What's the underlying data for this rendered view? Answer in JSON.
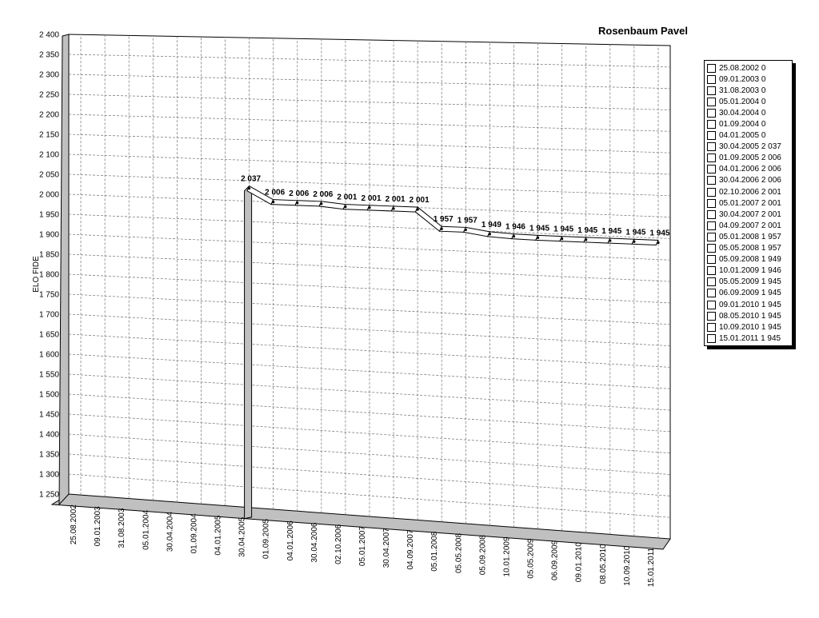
{
  "chart_data": {
    "type": "line",
    "title": "Rosenbaum Pavel",
    "ylabel": "ELO FIDE",
    "xlabel": "",
    "ylim": [
      1250,
      2400
    ],
    "ytick_step": 50,
    "yticks": [
      "1 250",
      "1 300",
      "1 350",
      "1 400",
      "1 450",
      "1 500",
      "1 550",
      "1 600",
      "1 650",
      "1 700",
      "1 750",
      "1 800",
      "1 850",
      "1 900",
      "1 950",
      "2 000",
      "2 050",
      "2 100",
      "2 150",
      "2 200",
      "2 250",
      "2 300",
      "2 350",
      "2 400"
    ],
    "grid": true,
    "legend_position": "right",
    "categories": [
      "25.08.2002",
      "09.01.2003",
      "31.08.2003",
      "05.01.2004",
      "30.04.2004",
      "01.09.2004",
      "04.01.2005",
      "30.04.2005",
      "01.09.2005",
      "04.01.2006",
      "30.04.2006",
      "02.10.2006",
      "05.01.2007",
      "30.04.2007",
      "04.09.2007",
      "05.01.2008",
      "05.05.2008",
      "05.09.2008",
      "10.01.2009",
      "05.05.2009",
      "06.09.2009",
      "09.01.2010",
      "08.05.2010",
      "10.09.2010",
      "15.01.2011"
    ],
    "values": [
      0,
      0,
      0,
      0,
      0,
      0,
      0,
      2037,
      2006,
      2006,
      2006,
      2001,
      2001,
      2001,
      2001,
      1957,
      1957,
      1949,
      1946,
      1945,
      1945,
      1945,
      1945,
      1945,
      1945
    ],
    "data_labels": [
      "",
      "",
      "",
      "",
      "",
      "",
      "",
      "2 037",
      "2 006",
      "2 006",
      "2 006",
      "2 001",
      "2 001",
      "2 001",
      "2 001",
      "1 957",
      "1 957",
      "1 949",
      "1 946",
      "1 945",
      "1 945",
      "1 945",
      "1 945",
      "1 945",
      "1 945"
    ],
    "legend_entries": [
      "25.08.2002 0",
      "09.01.2003 0",
      "31.08.2003 0",
      "05.01.2004 0",
      "30.04.2004 0",
      "01.09.2004 0",
      "04.01.2005 0",
      "30.04.2005 2 037",
      "01.09.2005 2 006",
      "04.01.2006 2 006",
      "30.04.2006 2 006",
      "02.10.2006 2 001",
      "05.01.2007 2 001",
      "30.04.2007 2 001",
      "04.09.2007 2 001",
      "05.01.2008 1 957",
      "05.05.2008 1 957",
      "05.09.2008 1 949",
      "10.01.2009 1 946",
      "05.05.2009 1 945",
      "06.09.2009 1 945",
      "09.01.2010 1 945",
      "08.05.2010 1 945",
      "10.09.2010 1 945",
      "15.01.2011 1 945"
    ],
    "colors": {
      "line_fill": "#ffffff",
      "line_stroke": "#000000",
      "wall": "#c0c0c0",
      "grid": "#808080"
    }
  }
}
